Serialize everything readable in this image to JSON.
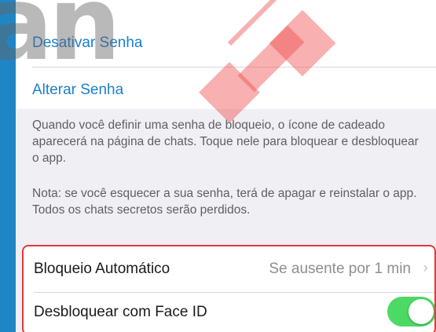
{
  "passcode": {
    "disable_label": "Desativar Senha",
    "change_label": "Alterar Senha",
    "info_text": "Quando você definir uma senha de bloqueio, o ícone de cadeado aparecerá na página de chats. Toque nele para bloquear e desbloquear o app.",
    "note_text": "Nota: se você esquecer a sua senha, terá de apagar e reinstalar o app. Todos os chats secretos serão perdidos."
  },
  "auto_lock": {
    "label": "Bloqueio Automático",
    "value": "Se ausente por 1 min",
    "chevron_icon": "chevron-right-icon"
  },
  "face_id": {
    "label": "Desbloquear com Face ID",
    "enabled": true
  },
  "watermark": {
    "letters": "an"
  },
  "colors": {
    "accent": "#1a7fd0",
    "toggle_on": "#4cd964",
    "highlight_border": "#e03a3a",
    "outer_background": "#1f86c6"
  }
}
